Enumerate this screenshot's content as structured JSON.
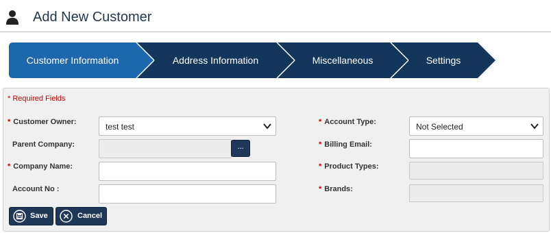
{
  "page": {
    "title": "Add New Customer",
    "icon": "user-icon"
  },
  "wizard": {
    "steps": [
      {
        "label": "Customer Information",
        "active": true
      },
      {
        "label": "Address Information",
        "active": false
      },
      {
        "label": "Miscellaneous",
        "active": false
      },
      {
        "label": "Settings",
        "active": false
      }
    ],
    "colors": {
      "active": "#1d67ac",
      "inactive": "#14355c"
    }
  },
  "form": {
    "required_note": "* Required Fields",
    "left": {
      "customer_owner": {
        "label": "Customer Owner:",
        "required": true,
        "value": "test test"
      },
      "parent_company": {
        "label": "Parent Company:",
        "required": false,
        "value": "",
        "lookup_label": "..."
      },
      "company_name": {
        "label": "Company Name:",
        "required": true,
        "value": ""
      },
      "account_no": {
        "label": "Account No :",
        "required": false,
        "value": ""
      }
    },
    "right": {
      "account_type": {
        "label": "Account Type:",
        "required": true,
        "value": "Not Selected"
      },
      "billing_email": {
        "label": "Billing Email:",
        "required": true,
        "value": ""
      },
      "product_types": {
        "label": "Product Types:",
        "required": true,
        "value": ""
      },
      "brands": {
        "label": "Brands:",
        "required": true,
        "value": ""
      }
    }
  },
  "actions": {
    "save": {
      "label": "Save",
      "icon": "save-icon"
    },
    "cancel": {
      "label": "Cancel",
      "icon": "close-circle-icon"
    }
  },
  "required_star": "*"
}
